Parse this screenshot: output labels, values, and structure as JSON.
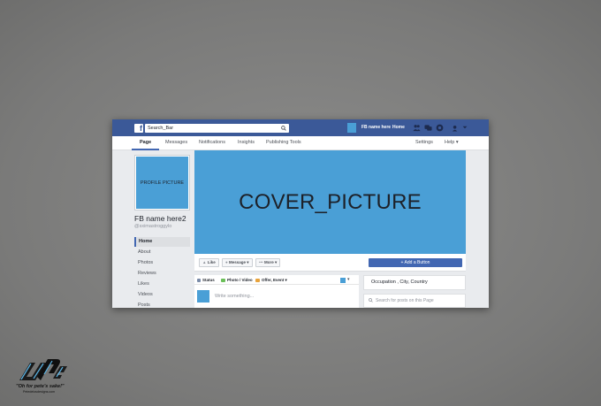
{
  "colors": {
    "brand": "#3b5998",
    "placeholder": "#4a9fd6",
    "button": "#4267b2",
    "background": "#7f7f7e"
  },
  "topbar": {
    "search_value": "Search_Bar",
    "page_name": "FB name here",
    "home": "Home",
    "icons": [
      "friends-icon",
      "messages-icon",
      "notifications-icon",
      "help-icon"
    ]
  },
  "tabs": {
    "page": "Page",
    "messages": "Messages",
    "notifications": "Notifications",
    "insights": "Insights",
    "publishing_tools": "Publishing Tools",
    "settings": "Settings",
    "help": "Help ▾"
  },
  "profile": {
    "picture_label": "PROFILE PICTURE",
    "name": "FB name here2",
    "handle": "@sximastroggylo"
  },
  "sidebar": [
    "Home",
    "About",
    "Photos",
    "Reviews",
    "Likes",
    "Videos",
    "Posts"
  ],
  "cover": {
    "label": "COVER_PICTURE"
  },
  "actions": {
    "like": "Like",
    "message": "Message ▾",
    "more": "More ▾",
    "add_button": "+ Add a Button"
  },
  "composer": {
    "status": "Status",
    "photo_video": "Photo / Video",
    "offer_event": "Offer, Event ▾",
    "placeholder": "Write something..."
  },
  "info": {
    "occupation": "Occupation ,  City, Country",
    "search_placeholder": "Search for posts on this Page"
  },
  "watermark": {
    "tagline": "\"Oh for pete's sake!\"",
    "site": "Petedelosdesigns.com"
  }
}
